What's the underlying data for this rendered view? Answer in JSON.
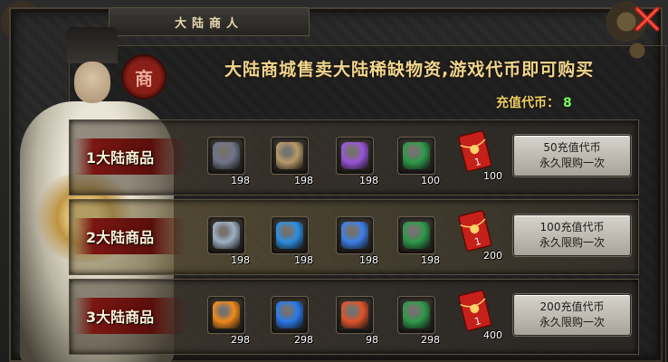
{
  "window": {
    "title": "大陆商人"
  },
  "seal_char": "商",
  "headline": "大陆商城售卖大陆稀缺物资,游戏代币即可购买",
  "currency": {
    "label": "充值代币：",
    "value": "8"
  },
  "rows": [
    {
      "label": "1大陆商品",
      "items": [
        {
          "icon": "dark-ore-icon",
          "qty": "198",
          "color": "#6f7488"
        },
        {
          "icon": "scroll-icon",
          "qty": "198",
          "color": "#b89a6a"
        },
        {
          "icon": "purple-crystal-icon",
          "qty": "198",
          "color": "#9a55d8"
        },
        {
          "icon": "green-jade-icon",
          "qty": "100",
          "color": "#2f9a4a"
        },
        {
          "icon": "red-envelope-icon",
          "qty": "100",
          "color": "#c5201a"
        }
      ],
      "button": {
        "line1": "50充值代币",
        "line2": "永久限购一次"
      }
    },
    {
      "label": "2大陆商品",
      "items": [
        {
          "icon": "silver-crystal-icon",
          "qty": "198",
          "color": "#9fb1c4"
        },
        {
          "icon": "blue-feather-icon",
          "qty": "198",
          "color": "#2d8fe0"
        },
        {
          "icon": "blue-gem-icon",
          "qty": "198",
          "color": "#3e7fe6"
        },
        {
          "icon": "green-jade-icon",
          "qty": "198",
          "color": "#2f9a4a"
        },
        {
          "icon": "red-envelope-icon",
          "qty": "200",
          "color": "#c5201a"
        }
      ],
      "button": {
        "line1": "100充值代币",
        "line2": "永久限购一次"
      }
    },
    {
      "label": "3大陆商品",
      "items": [
        {
          "icon": "orange-orb-icon",
          "qty": "298",
          "color": "#f08a1c"
        },
        {
          "icon": "blue-orb-icon",
          "qty": "298",
          "color": "#2a7ae8"
        },
        {
          "icon": "fire-talisman-icon",
          "qty": "98",
          "color": "#e0542a"
        },
        {
          "icon": "green-jade-icon",
          "qty": "298",
          "color": "#2f9a4a"
        },
        {
          "icon": "red-envelope-icon",
          "qty": "400",
          "color": "#c5201a"
        }
      ],
      "button": {
        "line1": "200充值代币",
        "line2": "永久限购一次"
      }
    }
  ]
}
